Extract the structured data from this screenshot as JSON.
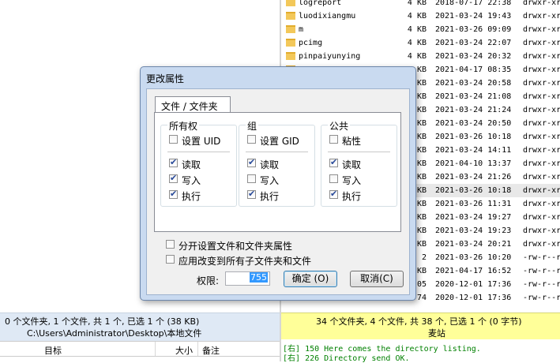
{
  "file_list": [
    {
      "name": "logreport",
      "size": "4 KB",
      "date": "2018-07-17 22:38",
      "perm": "drwxr-xr",
      "folder": true
    },
    {
      "name": "luodixiangmu",
      "size": "4 KB",
      "date": "2021-03-24 19:43",
      "perm": "drwxr-xr",
      "folder": true
    },
    {
      "name": "m",
      "size": "4 KB",
      "date": "2021-03-26 09:09",
      "perm": "drwxr-xr",
      "folder": true
    },
    {
      "name": "pcimg",
      "size": "4 KB",
      "date": "2021-03-24 22:07",
      "perm": "drwxr-xr",
      "folder": true
    },
    {
      "name": "pinpaiyunying",
      "size": "4 KB",
      "date": "2021-03-24 20:32",
      "perm": "drwxr-xr",
      "folder": true
    },
    {
      "name": "",
      "size": "4 KB",
      "date": "2021-04-17 08:35",
      "perm": "drwxr-xr",
      "folder": true
    },
    {
      "name": "",
      "size": "4 KB",
      "date": "2021-03-24 20:58",
      "perm": "drwxr-xr",
      "folder": true
    },
    {
      "name": "",
      "size": "4 KB",
      "date": "2021-03-24 21:08",
      "perm": "drwxr-xr",
      "folder": true
    },
    {
      "name": "",
      "size": "4 KB",
      "date": "2021-03-24 21:24",
      "perm": "drwxr-xr",
      "folder": true
    },
    {
      "name": "",
      "size": "4 KB",
      "date": "2021-03-24 20:50",
      "perm": "drwxr-xr",
      "folder": true
    },
    {
      "name": "",
      "size": "4 KB",
      "date": "2021-03-26 10:18",
      "perm": "drwxr-xr",
      "folder": true
    },
    {
      "name": "",
      "size": "4 KB",
      "date": "2021-03-24 14:11",
      "perm": "drwxr-xr",
      "folder": true
    },
    {
      "name": "",
      "size": "4 KB",
      "date": "2021-04-10 13:37",
      "perm": "drwxr-xr",
      "folder": true
    },
    {
      "name": "",
      "size": "4 KB",
      "date": "2021-03-24 21:26",
      "perm": "drwxr-xr",
      "folder": true
    },
    {
      "name": "",
      "size": "4 KB",
      "date": "2021-03-26 10:18",
      "perm": "drwxr-xr",
      "folder": true,
      "selected": true
    },
    {
      "name": "",
      "size": "4 KB",
      "date": "2021-03-26 11:31",
      "perm": "drwxr-xr",
      "folder": true
    },
    {
      "name": "",
      "size": "4 KB",
      "date": "2021-03-24 19:27",
      "perm": "drwxr-xr",
      "folder": true
    },
    {
      "name": "",
      "size": "4 KB",
      "date": "2021-03-24 19:23",
      "perm": "drwxr-xr",
      "folder": true
    },
    {
      "name": "",
      "size": "4 KB",
      "date": "2021-03-24 20:21",
      "perm": "drwxr-xr",
      "folder": true
    },
    {
      "name": "",
      "size": "2",
      "date": "2021-03-26 10:20",
      "perm": "-rw-r--r",
      "folder": false
    },
    {
      "name": "",
      "size": "4 KB",
      "date": "2021-04-17 16:52",
      "perm": "-rw-r--r",
      "folder": false
    },
    {
      "name": "",
      "size": "05",
      "date": "2020-12-01 17:36",
      "perm": "-rw-r--r",
      "folder": false
    },
    {
      "name": "",
      "size": "74",
      "date": "2020-12-01 17:36",
      "perm": "-rw-r--r",
      "folder": false
    }
  ],
  "left_status": {
    "line1": "0 个文件夹, 1 个文件, 共 1 个, 已选 1 个 (38 KB)",
    "line2": "C:\\Users\\Administrator\\Desktop\\本地文件"
  },
  "right_status": {
    "line1": "34 个文件夹, 4 个文件, 共 38 个, 已选 1 个 (0 字节)",
    "line2": "麦站"
  },
  "queue_header": {
    "target": "目标",
    "size": "大小",
    "note": "备注"
  },
  "log": [
    {
      "tag": "[右]",
      "text": " 150 Here comes the directory listing."
    },
    {
      "tag": "[右]",
      "text": " 226 Directory send OK."
    }
  ],
  "dialog": {
    "title": "更改属性",
    "tab_label": "文件 / 文件夹",
    "groups": [
      {
        "title": "所有权",
        "special": {
          "label": "设置 UID",
          "checked": false
        },
        "read": {
          "label": "读取",
          "checked": true
        },
        "write": {
          "label": "写入",
          "checked": true
        },
        "exec": {
          "label": "执行",
          "checked": true
        }
      },
      {
        "title": "组",
        "special": {
          "label": "设置 GID",
          "checked": false
        },
        "read": {
          "label": "读取",
          "checked": true
        },
        "write": {
          "label": "写入",
          "checked": false
        },
        "exec": {
          "label": "执行",
          "checked": true
        }
      },
      {
        "title": "公共",
        "special": {
          "label": "粘性",
          "checked": false
        },
        "read": {
          "label": "读取",
          "checked": true
        },
        "write": {
          "label": "写入",
          "checked": false
        },
        "exec": {
          "label": "执行",
          "checked": true
        }
      }
    ],
    "option_separate": {
      "label": "分开设置文件和文件夹属性",
      "checked": false
    },
    "option_recursive": {
      "label": "应用改变到所有子文件夹和文件",
      "checked": false
    },
    "perm_label": "权限:",
    "perm_value": "755",
    "ok_label": "确定 (O)",
    "cancel_label": "取消(C)"
  },
  "colors": {
    "right_status_bg": "#ffff99",
    "left_status_bg": "#dfe9f5",
    "dialog_frame": "#c9daf0",
    "log_text": "#008000",
    "folder": "#f3c85a"
  }
}
